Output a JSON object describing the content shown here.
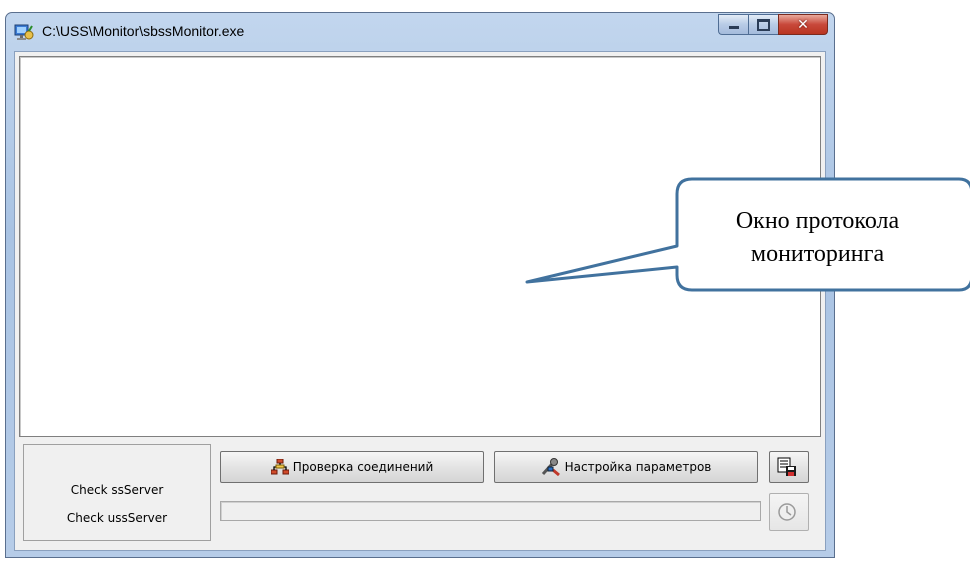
{
  "window": {
    "title": "C:\\USS\\Monitor\\sbssMonitor.exe",
    "controls": {
      "minimize": "minimize",
      "maximize": "maximize",
      "close": "close"
    }
  },
  "status": {
    "check_ss": "Check ssServer",
    "check_uss": "Check ussServer"
  },
  "toolbar": {
    "check_connections_label": "Проверка соединений",
    "settings_label": "Настройка параметров",
    "save_icon": "save-log-icon",
    "disabled_icon": "clock-icon"
  },
  "progress": {
    "value": 0
  },
  "callout": {
    "line1": "Окно протокола",
    "line2": "мониторинга"
  }
}
